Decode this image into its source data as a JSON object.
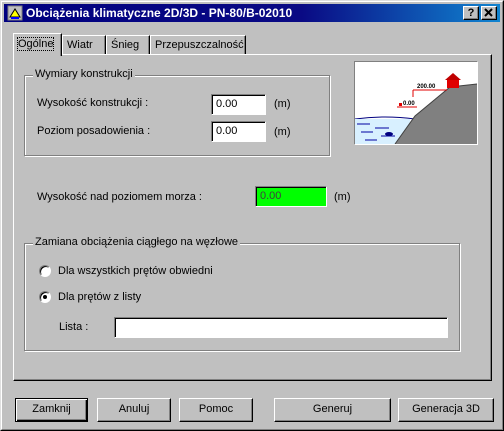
{
  "window": {
    "title": "Obciążenia klimatyczne 2D/3D  -  PN-80/B-02010",
    "help_label": "?",
    "close_label": "×"
  },
  "tabs": [
    {
      "label": "Ogólne",
      "active": true
    },
    {
      "label": "Wiatr",
      "active": false
    },
    {
      "label": "Śnieg",
      "active": false
    },
    {
      "label": "Przepuszczalność",
      "active": false
    }
  ],
  "dimensions_group": {
    "title": "Wymiary konstrukcji",
    "height_label": "Wysokość konstrukcji :",
    "height_value": "0.00",
    "height_unit": "(m)",
    "foundation_label": "Poziom posadowienia :",
    "foundation_value": "0.00",
    "foundation_unit": "(m)"
  },
  "illustration": {
    "label_top": "200.00",
    "label_bottom": "0.00"
  },
  "sea_level": {
    "label": "Wysokość nad poziomem morza :",
    "value": "0.00",
    "unit": "(m)"
  },
  "conversion_group": {
    "title": "Zamiana obciążenia ciągłego na węzłowe",
    "option_all": "Dla wszystkich prętów obwiedni",
    "option_list": "Dla prętów z listy",
    "selected": "option_list",
    "list_label": "Lista :",
    "list_value": ""
  },
  "buttons": {
    "close": "Zamknij",
    "cancel": "Anuluj",
    "help": "Pomoc",
    "generate": "Generuj",
    "generate3d": "Generacja 3D"
  },
  "colors": {
    "title_bar": "#000080",
    "sea_level_field": "#00ff00",
    "house": "#e00000"
  }
}
